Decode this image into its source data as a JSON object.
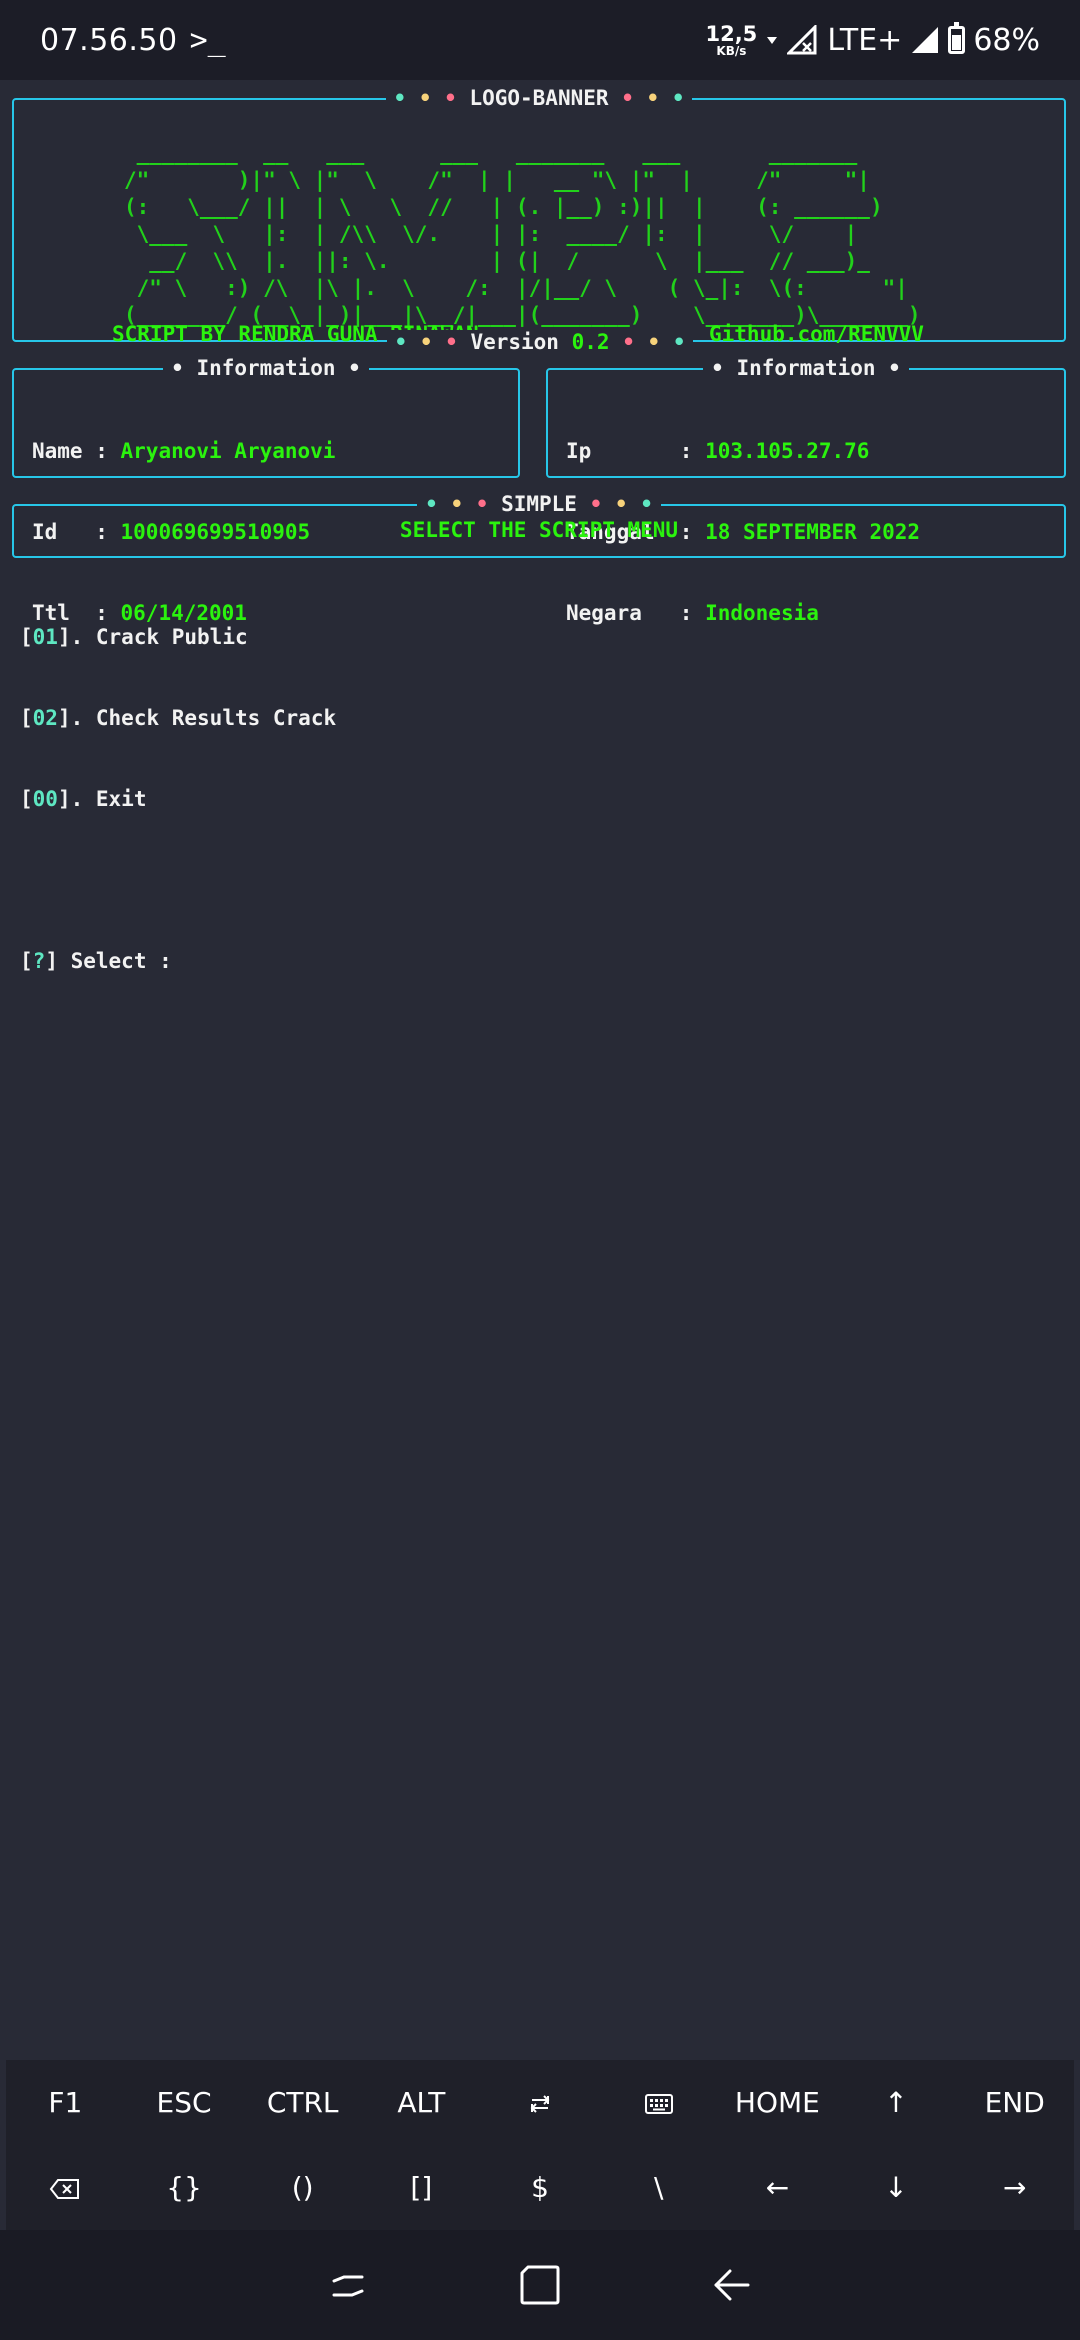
{
  "status_bar": {
    "time": "07.56.50",
    "term_icon": ">_",
    "net_speed": "12,5",
    "net_unit": "KB/s",
    "network": "LTE+",
    "battery": "68%"
  },
  "banner": {
    "title": "LOGO-BANNER",
    "ascii_art": " ________  __   ___      ___   _______   ___       _______  \n/\"       )|\" \\ |\"  \\    /\"  | |   __ \"\\ |\"  |     /\"     \"| \n(:   \\___/ ||  | \\   \\  //   | (. |__) :)||  |    (: ______) \n \\___  \\   |:  | /\\\\  \\/.    | |:  ____/ |:  |     \\/    |   \n  __/  \\\\  |.  ||: \\.        | (|  /      \\  |___  // ___)_  \n /\" \\   :) /\\  |\\ |.  \\    /:  |/|__/ \\    ( \\_|:  \\(:      \"| \n(_______/ (__\\_|_)|___|\\__/|___|(_______)    \\_______)\\_______) ",
    "credit_left": "SCRIPT BY RENDRA GUNA BINAWAN",
    "credit_right": "Github.com/RENVVV"
  },
  "version": {
    "label": "Version",
    "number": "0.2"
  },
  "info_left": {
    "title": "• Information •",
    "rows": [
      {
        "key": "Name",
        "sep": " : ",
        "value": "Aryanovi Aryanovi"
      },
      {
        "key": "Id  ",
        "sep": " : ",
        "value": "100069699510905"
      },
      {
        "key": "Ttl ",
        "sep": " : ",
        "value": "06/14/2001"
      }
    ]
  },
  "info_right": {
    "title": "• Information •",
    "rows": [
      {
        "key": "Ip      ",
        "sep": " : ",
        "value": "103.105.27.76"
      },
      {
        "key": "Tanggal ",
        "sep": " : ",
        "value": "18 SEPTEMBER 2022"
      },
      {
        "key": "Negara  ",
        "sep": " : ",
        "value": "Indonesia"
      }
    ]
  },
  "menu_box": {
    "title": "SIMPLE",
    "subtitle": "SELECT THE SCRIPT MENU"
  },
  "menu": {
    "items": [
      {
        "num": "01",
        "label": ". Crack Public"
      },
      {
        "num": "02",
        "label": ". Check Results Crack"
      },
      {
        "num": "00",
        "label": ". Exit"
      }
    ],
    "prompt_mark": "?",
    "prompt_label": "] Select :"
  },
  "extra_keys": {
    "row1": [
      "F1",
      "ESC",
      "CTRL",
      "ALT",
      "tab-icon",
      "keyboard-icon",
      "HOME",
      "↑",
      "END"
    ],
    "row2": [
      "backspace-icon",
      "{}",
      "()",
      "[]",
      "$",
      "\\",
      "←",
      "↓",
      "→"
    ]
  },
  "colors": {
    "background": "#282a36",
    "border": "#27c6e8",
    "green": "#2bf30e",
    "accent_cyan": "#5ee7c2",
    "accent_yellow": "#f7d27b",
    "accent_pink": "#ff6f8a"
  }
}
